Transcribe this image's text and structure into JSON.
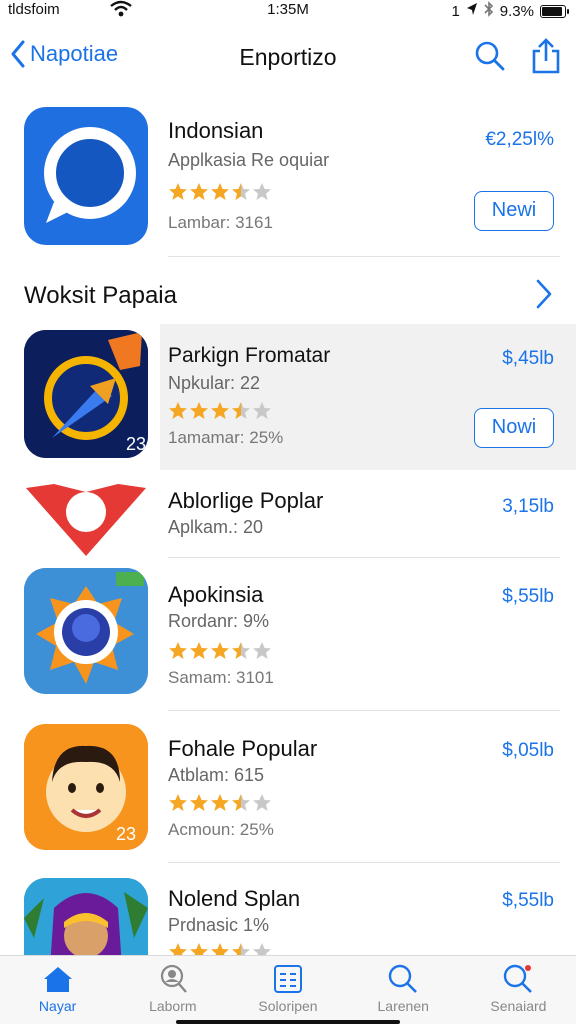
{
  "status": {
    "carrier": "tldsfoim",
    "time": "1:35M",
    "signal": "1",
    "battery_pct": "9.3%",
    "battery_level": 0.93
  },
  "nav": {
    "back_label": "Napotiae",
    "title": "Enportizo"
  },
  "featured": {
    "name": "Indonsian",
    "subtitle": "Applkasia Re oquiar",
    "meta": "Lambar: 3161",
    "price": "€2,25l%",
    "button": "Newi",
    "rating": 3.5
  },
  "section": {
    "title": "Woksit Papaia"
  },
  "apps": [
    {
      "name": "Parkign Fromatar",
      "subtitle": "Npkular: 22",
      "meta": "1amamar: 25%",
      "price": "$,45lb",
      "button": "Nowi",
      "rating": 3.5,
      "badge": "23"
    },
    {
      "name": "Ablorlige Poplar",
      "subtitle": "Aplkam.: 20",
      "meta": "",
      "price": "3,15lb",
      "button": "",
      "rating": 0
    },
    {
      "name": "Apokinsia",
      "subtitle": "Rordanr: 9%",
      "meta": "Samam: 3101",
      "price": "$,55lb",
      "button": "",
      "rating": 3.5
    },
    {
      "name": "Fohale Popular",
      "subtitle": "Atblam: 615",
      "meta": "Acmoun: 25%",
      "price": "$,05lb",
      "button": "",
      "rating": 3.5,
      "badge": "23"
    },
    {
      "name": "Nolend Splan",
      "subtitle": "Prdnasic 1%",
      "meta": "",
      "price": "$,55lb",
      "button": "",
      "rating": 3.5
    }
  ],
  "tabs": [
    {
      "label": "Nayar",
      "icon": "home-icon",
      "active": true
    },
    {
      "label": "Laborm",
      "icon": "profile-search-icon",
      "active": false
    },
    {
      "label": "Soloripen",
      "icon": "list-icon",
      "active": false
    },
    {
      "label": "Larenen",
      "icon": "search-icon",
      "active": false
    },
    {
      "label": "Senaiard",
      "icon": "search-badge-icon",
      "active": false
    }
  ],
  "colors": {
    "accent": "#1a73e8",
    "star": "#f5a623",
    "star_empty": "#c8c8c8"
  }
}
